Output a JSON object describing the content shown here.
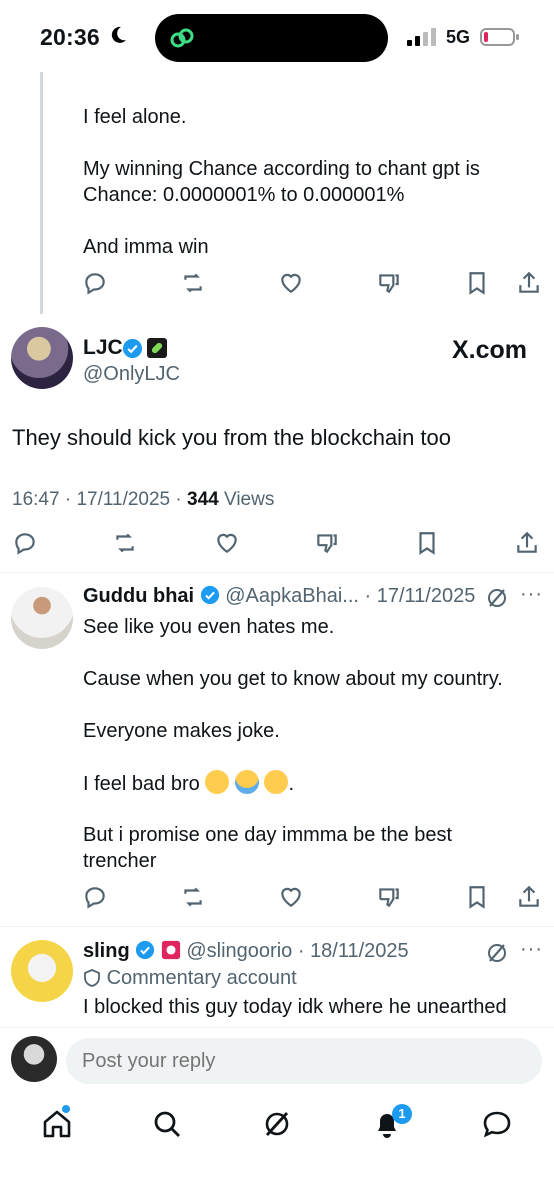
{
  "status_bar": {
    "time": "20:36",
    "network": "5G"
  },
  "thread_post": {
    "text": "I feel alone.\n\nMy winning Chance according to chant gpt is\nChance: 0.0000001% to 0.000001%\n\nAnd imma win"
  },
  "main_post": {
    "author": "LJC",
    "handle": "@OnlyLJC",
    "source": "X.com",
    "text": "They should kick you from the blockchain too",
    "time": "16:47",
    "date": "17/11/2025",
    "views_count": "344",
    "views_label": "Views"
  },
  "reply1": {
    "author": "Guddu bhai",
    "handle": "@AapkaBhai...",
    "date": "17/11/2025",
    "text": "See like you even hates me.\n\nCause when you get to know about my country.\n\nEveryone makes joke.\n\nI feel bad bro",
    "text_end": ".",
    "text2": "But i promise one day immma be the best\ntrencher"
  },
  "reply2": {
    "author": "sling",
    "handle": "@slingoorio",
    "date": "18/11/2025",
    "label": "Commentary account",
    "text": "I blocked this guy today idk where he unearthed"
  },
  "composer": {
    "placeholder": "Post your reply"
  },
  "tabbar": {
    "notifications_badge": "1"
  },
  "colors": {
    "accent": "#1d9bf0",
    "muted": "#536471",
    "text": "#0f1419"
  }
}
